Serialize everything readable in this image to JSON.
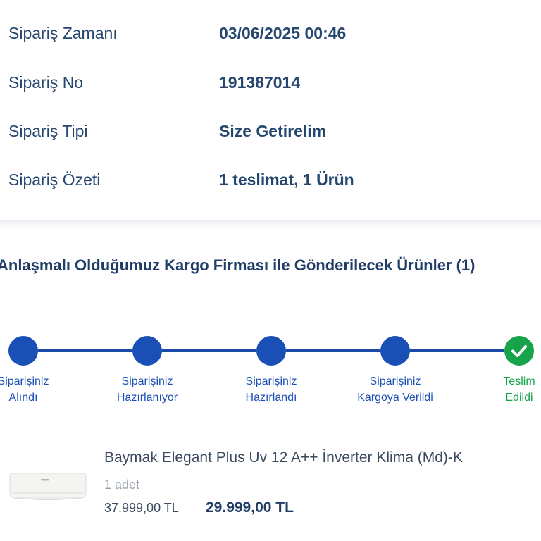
{
  "order_info": [
    {
      "label": "Sipariş Zamanı",
      "value": "03/06/2025 00:46"
    },
    {
      "label": "Sipariş No",
      "value": "191387014"
    },
    {
      "label": "Sipariş Tipi",
      "value": "Size Getirelim"
    },
    {
      "label": "Sipariş Özeti",
      "value": "1 teslimat, 1 Ürün"
    }
  ],
  "shipment": {
    "title": "Anlaşmalı Olduğumuz Kargo Firması ile Gönderilecek Ürünler (1)",
    "steps": [
      {
        "line1": "Siparişiniz",
        "line2": "Alındı",
        "done": false
      },
      {
        "line1": "Siparişiniz",
        "line2": "Hazırlanıyor",
        "done": false
      },
      {
        "line1": "Siparişiniz",
        "line2": "Hazırlandı",
        "done": false
      },
      {
        "line1": "Siparişiniz",
        "line2": "Kargoya Verildi",
        "done": false
      },
      {
        "line1": "Teslim",
        "line2": "Edildi",
        "done": true
      }
    ],
    "colors": {
      "active": "#1a4fb5",
      "done": "#16a34a"
    }
  },
  "product": {
    "name": "Baymak Elegant Plus Uv 12 A++ İnverter Klima (Md)-K",
    "quantity": "1 adet",
    "old_price": "37.999,00 TL",
    "price": "29.999,00 TL",
    "image_icon": "air-conditioner-image"
  }
}
